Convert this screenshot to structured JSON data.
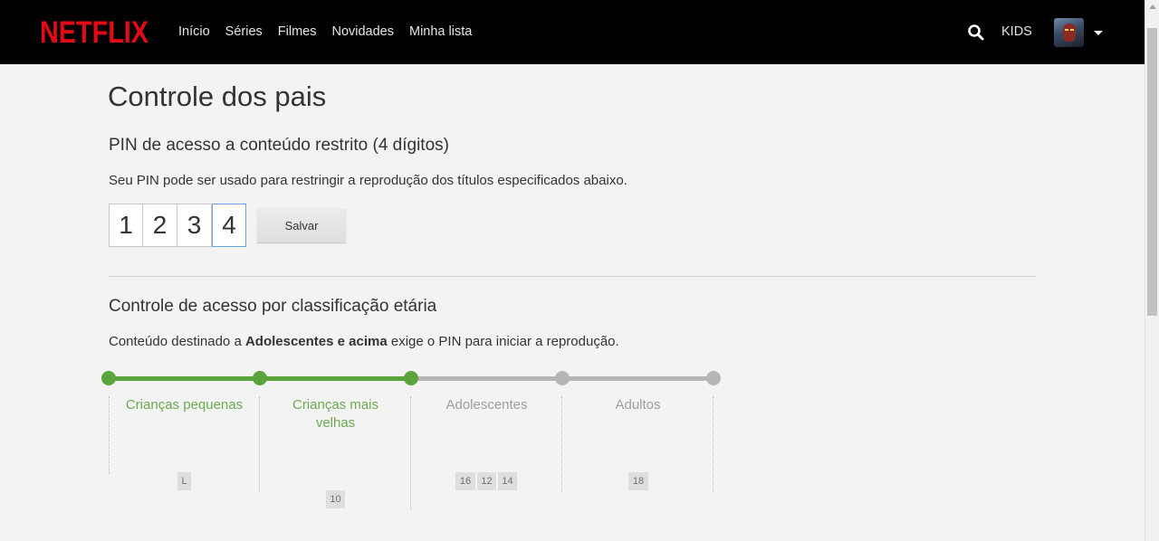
{
  "header": {
    "brand": "NETFLIX",
    "brand_color": "#e50914",
    "nav": [
      "Início",
      "Séries",
      "Filmes",
      "Novidades",
      "Minha lista"
    ],
    "search_icon": "search-icon",
    "kids_label": "KIDS",
    "profile_icon": "avatar",
    "menu_icon": "caret-down-icon"
  },
  "page": {
    "title": "Controle dos pais"
  },
  "pin": {
    "title": "PIN de acesso a conteúdo restrito (4 dígitos)",
    "description": "Seu PIN pode ser usado para restringir a reprodução dos títulos especificados abaixo.",
    "digits": [
      "1",
      "2",
      "3",
      "4"
    ],
    "save_label": "Salvar"
  },
  "rating": {
    "title": "Controle de acesso por classificação etária",
    "desc_prefix": "Conteúdo destinado a ",
    "desc_bold": "Adolescentes e acima",
    "desc_suffix": " exige o PIN para iniciar a reprodução.",
    "selected_level": 2,
    "active_color": "#5ba33b",
    "inactive_color": "#b6b6b6",
    "levels": [
      {
        "label": "Crianças pequenas",
        "badges": [
          "L"
        ]
      },
      {
        "label": "Crianças mais velhas",
        "badges": [
          "10"
        ]
      },
      {
        "label": "Adolescentes",
        "badges": [
          "16",
          "12",
          "14"
        ]
      },
      {
        "label": "Adultos",
        "badges": [
          "18"
        ]
      }
    ]
  }
}
